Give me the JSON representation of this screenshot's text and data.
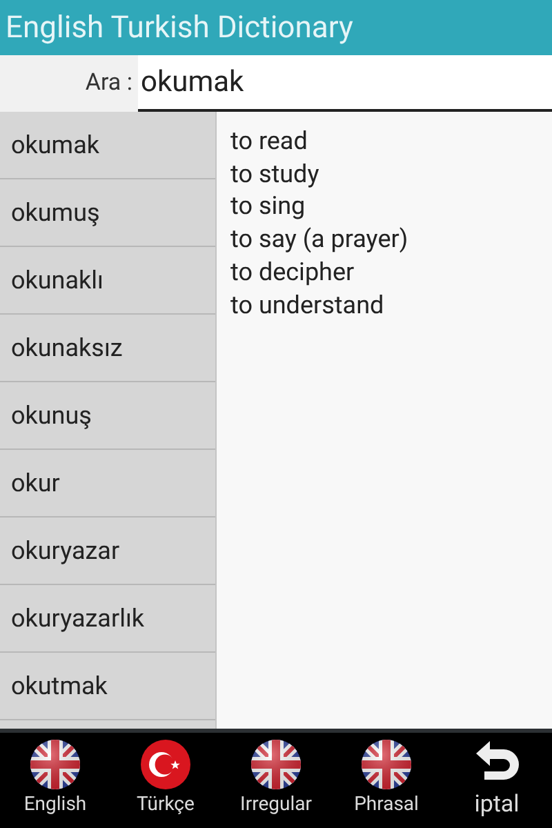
{
  "window": {
    "title": "English Turkish Dictionary"
  },
  "search": {
    "label": "Ara :",
    "value": "okumak"
  },
  "words": [
    "okumak",
    "okumuş",
    "okunaklı",
    "okunaksız",
    "okunuş",
    "okur",
    "okuryazar",
    "okuryazarlık",
    "okutmak"
  ],
  "meanings": [
    "to read",
    "to study",
    "to sing",
    "to say (a prayer)",
    "to decipher",
    "to understand"
  ],
  "bottom_bar": [
    {
      "label": "English",
      "kind": "uk"
    },
    {
      "label": "Türkçe",
      "kind": "tr"
    },
    {
      "label": "Irregular",
      "kind": "uk"
    },
    {
      "label": "Phrasal",
      "kind": "uk"
    },
    {
      "label": "iptal",
      "kind": "back"
    }
  ]
}
